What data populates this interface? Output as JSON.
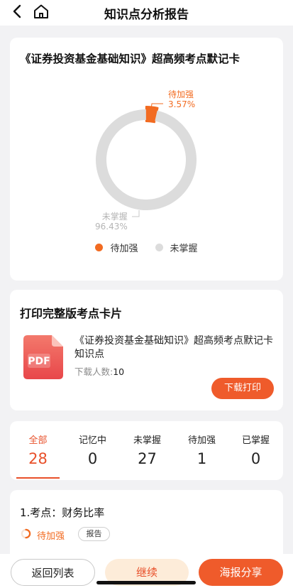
{
  "nav": {
    "title": "知识点分析报告"
  },
  "chart_card": {
    "title": "《证券投资基金基础知识》超高频考点默记卡",
    "chart_data": {
      "type": "pie",
      "categories": [
        "待加强",
        "未掌握"
      ],
      "values": [
        3.57,
        96.43
      ],
      "value_labels": [
        "3.57%",
        "96.43%"
      ],
      "colors": [
        "#f26b21",
        "#dcdcdc"
      ],
      "legend_position": "bottom"
    },
    "legend": [
      {
        "label": "待加强",
        "color": "#f26b21"
      },
      {
        "label": "未掌握",
        "color": "#dcdcdc"
      }
    ]
  },
  "print_card": {
    "title": "打印完整版考点卡片",
    "pdf_label": "PDF",
    "doc_name": "《证券投资基金基础知识》超高频考点默记卡知识点",
    "download_label": "下载人数:",
    "download_count": "10",
    "download_button": "下载打印"
  },
  "stats": {
    "tabs": [
      {
        "label": "全部",
        "count": "28"
      },
      {
        "label": "记忆中",
        "count": "0"
      },
      {
        "label": "未掌握",
        "count": "27"
      },
      {
        "label": "待加强",
        "count": "1"
      },
      {
        "label": "已掌握",
        "count": "0"
      }
    ]
  },
  "item": {
    "title": "1.考点：财务比率",
    "status": "待加强",
    "badge": "报告"
  },
  "bottom": {
    "back": "返回列表",
    "continue": "继续",
    "share": "海报分享"
  },
  "colors": {
    "accent": "#ef5b2b",
    "strong": "#f26b21",
    "unknown": "#dcdcdc"
  }
}
